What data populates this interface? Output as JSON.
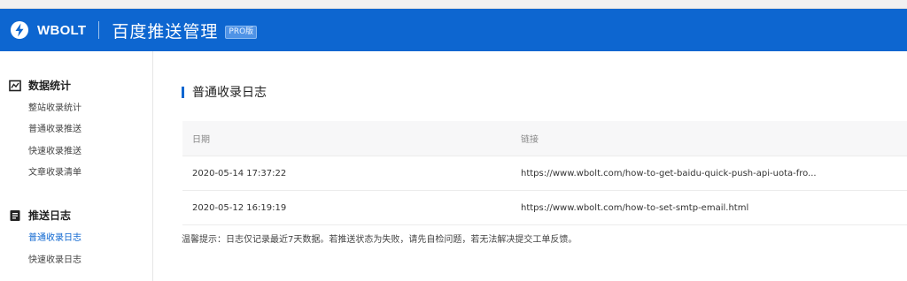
{
  "header": {
    "brand": "WBOLT",
    "title": "百度推送管理",
    "badge": "PRO版",
    "accent_color": "#0d66d0",
    "icon": "bolt-icon"
  },
  "sidebar": {
    "groups": [
      {
        "title": "数据统计",
        "icon": "chart-icon",
        "items": [
          {
            "label": "整站收录统计",
            "active": false
          },
          {
            "label": "普通收录推送",
            "active": false
          },
          {
            "label": "快速收录推送",
            "active": false
          },
          {
            "label": "文章收录清单",
            "active": false
          }
        ]
      },
      {
        "title": "推送日志",
        "icon": "document-icon",
        "items": [
          {
            "label": "普通收录日志",
            "active": true
          },
          {
            "label": "快速收录日志",
            "active": false
          }
        ]
      }
    ]
  },
  "main": {
    "section_title": "普通收录日志",
    "table": {
      "columns": [
        "日期",
        "链接"
      ],
      "rows": [
        {
          "date": "2020-05-14 17:37:22",
          "link": "https://www.wbolt.com/how-to-get-baidu-quick-push-api-uota-fro..."
        },
        {
          "date": "2020-05-12 16:19:19",
          "link": "https://www.wbolt.com/how-to-set-smtp-email.html"
        }
      ]
    },
    "tip": "温馨提示：日志仅记录最近7天数据。若推送状态为失败，请先自检问题，若无法解决提交工单反馈。"
  }
}
